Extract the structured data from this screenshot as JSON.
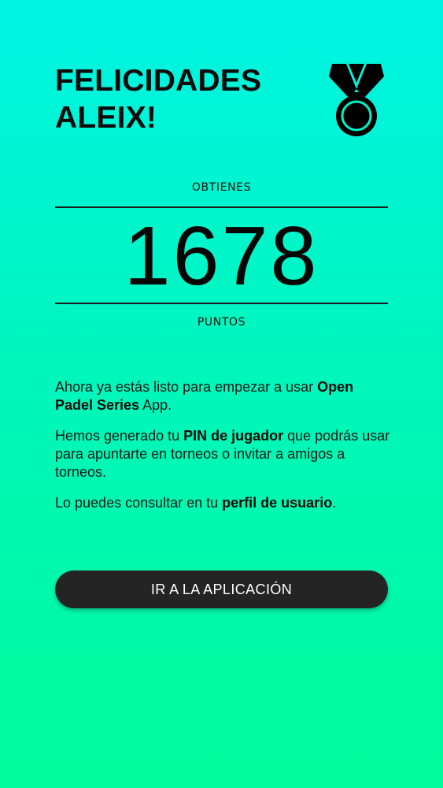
{
  "header": {
    "title_line1": "FELICIDADES",
    "title_line2": "ALEIX!",
    "medal_icon": "medal-icon"
  },
  "points": {
    "label_top": "OBTIENES",
    "value": "1678",
    "label_bottom": "PUNTOS"
  },
  "message": {
    "p1_text1": "Ahora ya estás listo para empezar a usar ",
    "p1_bold": "Open Padel Series",
    "p1_text2": " App.",
    "p2_text1": "Hemos generado tu ",
    "p2_bold": "PIN de jugador",
    "p2_text2": " que podrás usar para apuntarte en torneos o invitar a amigos a torneos.",
    "p3_text1": "Lo puedes consultar en tu ",
    "p3_bold": "perfil de usuario",
    "p3_text2": "."
  },
  "actions": {
    "cta_label": "IR A LA APLICACIÓN"
  },
  "colors": {
    "gradient_top": "#00f3e4",
    "gradient_bottom": "#00fb9a",
    "button_bg": "#242424",
    "button_text": "#ffffff"
  }
}
